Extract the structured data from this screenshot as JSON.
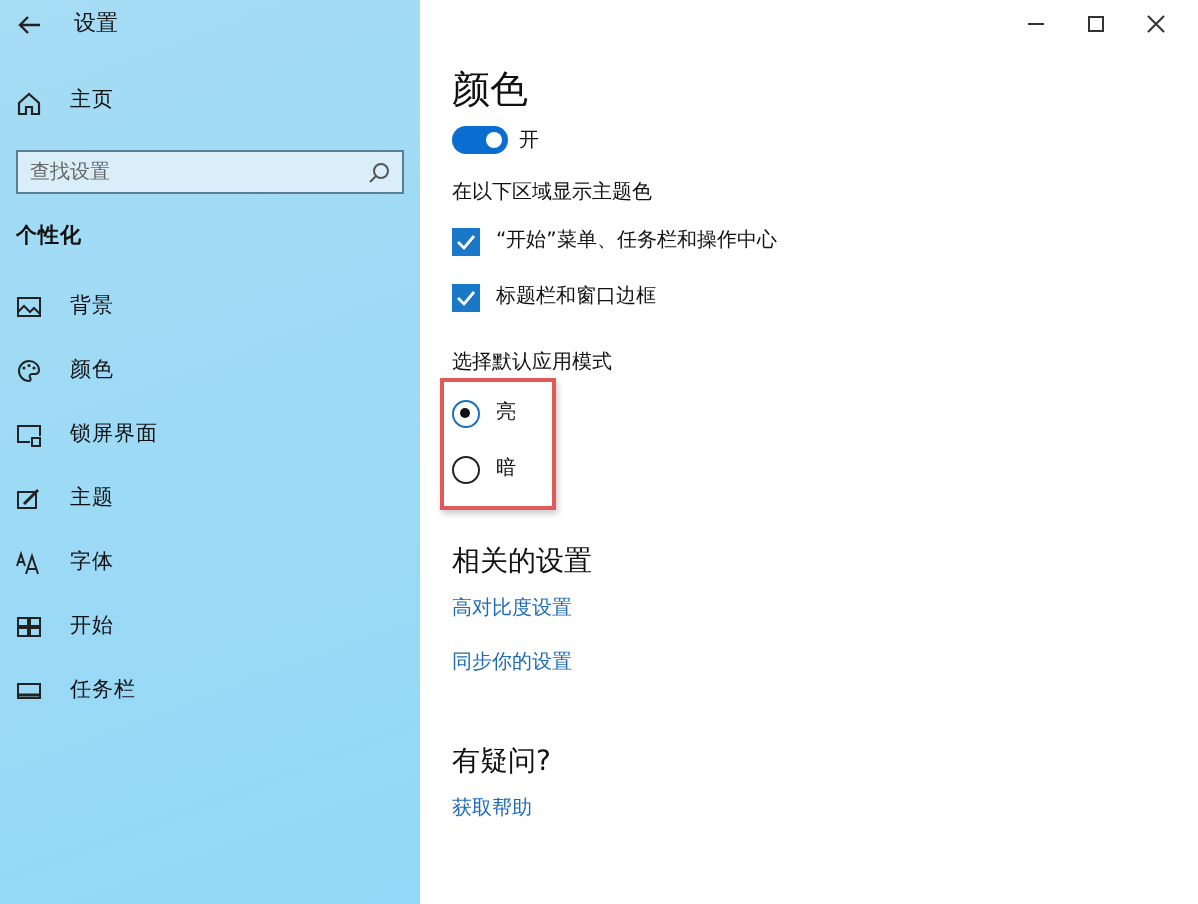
{
  "window": {
    "title": "设置"
  },
  "sidebar": {
    "home": "主页",
    "search": {
      "placeholder": "查找设置"
    },
    "section": "个性化",
    "items": [
      {
        "label": "背景"
      },
      {
        "label": "颜色"
      },
      {
        "label": "锁屏界面"
      },
      {
        "label": "主题"
      },
      {
        "label": "字体"
      },
      {
        "label": "开始"
      },
      {
        "label": "任务栏"
      }
    ]
  },
  "page": {
    "title": "颜色",
    "toggle": {
      "on": true,
      "label": "开"
    },
    "accent_heading": "在以下区域显示主题色",
    "checkboxes": [
      {
        "label": "“开始”菜单、任务栏和操作中心",
        "checked": true
      },
      {
        "label": "标题栏和窗口边框",
        "checked": true
      }
    ],
    "mode_heading": "选择默认应用模式",
    "modes": [
      {
        "label": "亮",
        "selected": true
      },
      {
        "label": "暗",
        "selected": false
      }
    ],
    "related_heading": "相关的设置",
    "related_links": [
      "高对比度设置",
      "同步你的设置"
    ],
    "help_heading": "有疑问?",
    "help_links": [
      "获取帮助"
    ]
  }
}
